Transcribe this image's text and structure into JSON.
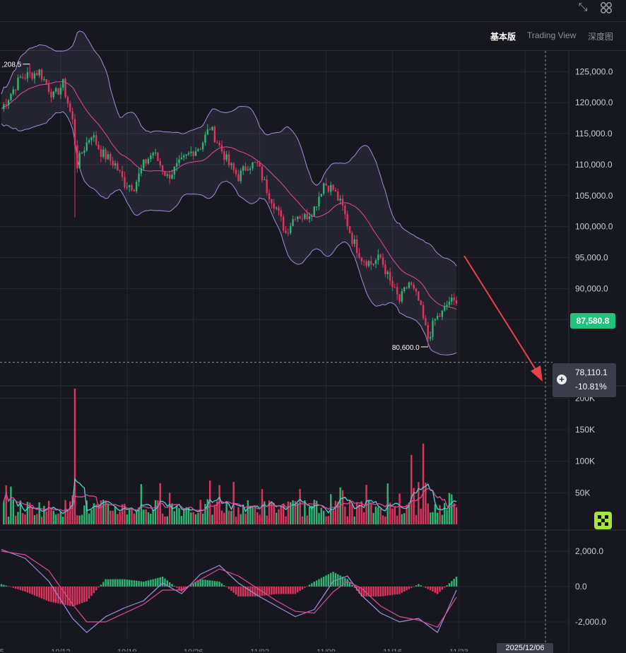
{
  "header": {
    "view_tabs": [
      "基本版",
      "Trading View",
      "深度图"
    ],
    "active_view": "基本版",
    "icons": [
      "collapse-arrows-icon",
      "layout-grid-icon"
    ]
  },
  "colors": {
    "background": "#17181f",
    "grid": "#262833",
    "up": "#2bb673",
    "down": "#e0345f",
    "bollinger_band": "#9b8fd8",
    "middle_line": "#e0489a",
    "volume_ma1": "#4fd2d4",
    "volume_ma2": "#e0489a",
    "price_tag": "#22c17c",
    "annotation_arrow": "#e8414b",
    "brand_button": "#a4e43c"
  },
  "price_labels": {
    "last_price": "87,580.8",
    "crosshair_price": "78,110.1",
    "crosshair_change": "-10.81%",
    "high_marker": ",208.5",
    "low_marker": "80,600.0"
  },
  "crosshair_date": "2025/12/06 20:00",
  "chart_data": [
    {
      "type": "candlestick",
      "ylim": [
        75000,
        128000
      ],
      "y_ticks": [
        "125,000.0",
        "120,000.0",
        "115,000.0",
        "110,000.0",
        "105,000.0",
        "100,000.0",
        "95,000.0",
        "90,000.0",
        "85,000.0"
      ],
      "y_tick_values": [
        125000,
        120000,
        115000,
        110000,
        105000,
        100000,
        95000,
        90000,
        85000
      ],
      "x_ticks": [
        "10/05",
        "10/12",
        "10/19",
        "10/26",
        "11/02",
        "11/09",
        "11/16",
        "11/23",
        "11/30"
      ],
      "indicators": [
        "Bollinger Bands",
        "Moving Average"
      ],
      "last_price": 87580.8,
      "marked_high": 126208.5,
      "marked_low": 80600.0,
      "crosshair_price": 78110.1,
      "close_path": [
        [
          0,
          119000
        ],
        [
          8,
          124000
        ],
        [
          16,
          125000
        ],
        [
          22,
          121000
        ],
        [
          26,
          123000
        ],
        [
          30,
          117000
        ],
        [
          32,
          110000
        ],
        [
          34,
          112000
        ],
        [
          38,
          115000
        ],
        [
          42,
          112000
        ],
        [
          48,
          110000
        ],
        [
          52,
          107000
        ],
        [
          56,
          106500
        ],
        [
          60,
          110000
        ],
        [
          64,
          112000
        ],
        [
          70,
          108000
        ],
        [
          75,
          110000
        ],
        [
          80,
          112000
        ],
        [
          84,
          113000
        ],
        [
          88,
          116000
        ],
        [
          92,
          113000
        ],
        [
          96,
          110000
        ],
        [
          100,
          108000
        ],
        [
          104,
          110000
        ],
        [
          108,
          110000
        ],
        [
          112,
          106000
        ],
        [
          116,
          103000
        ],
        [
          120,
          99000
        ],
        [
          124,
          102000
        ],
        [
          128,
          101500
        ],
        [
          132,
          103000
        ],
        [
          136,
          107000
        ],
        [
          140,
          106000
        ],
        [
          144,
          103000
        ],
        [
          148,
          98000
        ],
        [
          152,
          95000
        ],
        [
          156,
          94000
        ],
        [
          160,
          95000
        ],
        [
          164,
          91000
        ],
        [
          168,
          88000
        ],
        [
          172,
          91000
        ],
        [
          176,
          88000
        ],
        [
          180,
          82000
        ],
        [
          183,
          85000
        ],
        [
          186,
          86000
        ],
        [
          189,
          88000
        ],
        [
          192,
          87580.8
        ]
      ]
    },
    {
      "type": "bar",
      "name": "volume",
      "ylim": [
        0,
        215000
      ],
      "y_ticks": [
        "200K",
        "150K",
        "100K",
        "50K"
      ],
      "y_tick_values": [
        200000,
        150000,
        100000,
        50000
      ],
      "spikes": [
        [
          31,
          215000
        ],
        [
          178,
          128000
        ],
        [
          173,
          110000
        ]
      ]
    },
    {
      "type": "bar",
      "name": "MACD",
      "ylim": [
        -3000,
        3000
      ],
      "y_ticks": [
        "2,000.0",
        "0.0",
        "-2,000.0"
      ],
      "y_tick_values": [
        2000,
        0,
        -2000
      ],
      "dif_path": [
        [
          0,
          2100
        ],
        [
          10,
          1600
        ],
        [
          20,
          300
        ],
        [
          30,
          -1800
        ],
        [
          36,
          -2600
        ],
        [
          44,
          -1700
        ],
        [
          52,
          -1200
        ],
        [
          60,
          -800
        ],
        [
          68,
          200
        ],
        [
          76,
          -400
        ],
        [
          84,
          700
        ],
        [
          92,
          1200
        ],
        [
          100,
          200
        ],
        [
          108,
          -500
        ],
        [
          116,
          -1100
        ],
        [
          124,
          -1700
        ],
        [
          132,
          -1300
        ],
        [
          140,
          300
        ],
        [
          146,
          600
        ],
        [
          152,
          -500
        ],
        [
          160,
          -1500
        ],
        [
          168,
          -2000
        ],
        [
          176,
          -1800
        ],
        [
          184,
          -2600
        ],
        [
          192,
          -200
        ]
      ],
      "dea_path": [
        [
          0,
          2000
        ],
        [
          10,
          1800
        ],
        [
          20,
          900
        ],
        [
          30,
          -1000
        ],
        [
          36,
          -2000
        ],
        [
          44,
          -2000
        ],
        [
          52,
          -1500
        ],
        [
          60,
          -1000
        ],
        [
          68,
          -200
        ],
        [
          76,
          -200
        ],
        [
          84,
          400
        ],
        [
          92,
          1000
        ],
        [
          100,
          600
        ],
        [
          108,
          -100
        ],
        [
          116,
          -800
        ],
        [
          124,
          -1400
        ],
        [
          132,
          -1500
        ],
        [
          140,
          -300
        ],
        [
          146,
          300
        ],
        [
          152,
          -100
        ],
        [
          160,
          -1100
        ],
        [
          168,
          -1700
        ],
        [
          176,
          -1900
        ],
        [
          184,
          -2300
        ],
        [
          192,
          -600
        ]
      ]
    }
  ]
}
